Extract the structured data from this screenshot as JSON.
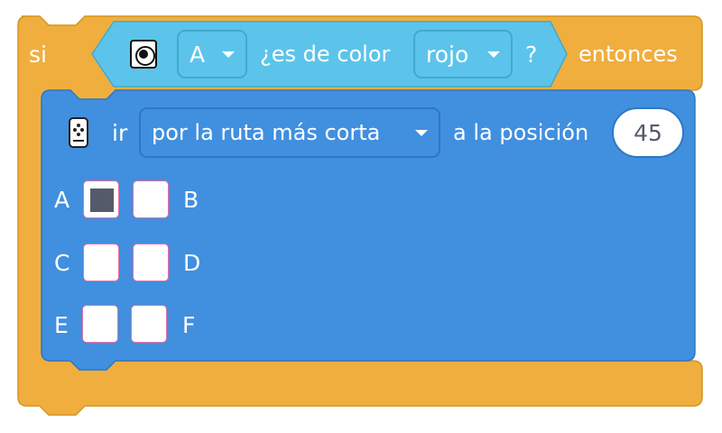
{
  "if_block": {
    "keyword_si": "si",
    "keyword_entonces": "entonces",
    "condition": {
      "sensor_icon": "color-sensor-icon",
      "port": "A",
      "text": "¿es de color",
      "color": "rojo",
      "question_mark": "?"
    }
  },
  "move_block": {
    "icon": "remote-control-icon",
    "verb": "ir",
    "route": "por la ruta más corta",
    "position_label": "a la posición",
    "position_value": "45"
  },
  "port_grid": {
    "labels": [
      "A",
      "B",
      "C",
      "D",
      "E",
      "F"
    ],
    "checked": [
      true,
      false,
      false,
      false,
      false,
      false
    ]
  },
  "colors": {
    "control_orange": "#f0ae3f",
    "sensor_cyan": "#5cc4ea",
    "motor_blue": "#418fdf",
    "checkbox_fill": "#555a6b"
  }
}
